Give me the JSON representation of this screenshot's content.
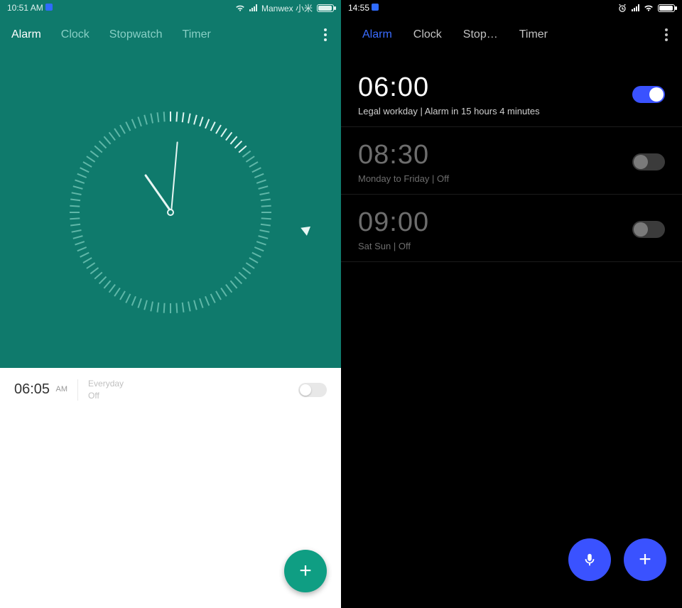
{
  "left": {
    "status": {
      "time": "10:51 AM",
      "carrier": "Manwex 小米"
    },
    "tabs": [
      "Alarm",
      "Clock",
      "Stopwatch",
      "Timer"
    ],
    "active_tab": "Alarm",
    "alarm": {
      "time": "06:05",
      "ampm": "AM",
      "repeat": "Everyday",
      "state": "Off"
    }
  },
  "right": {
    "status": {
      "time": "14:55"
    },
    "tabs": [
      "Alarm",
      "Clock",
      "Stop…",
      "Timer"
    ],
    "active_tab": "Alarm",
    "alarms": [
      {
        "time": "06:00",
        "sub": "Legal workday  |  Alarm in 15 hours 4 minutes",
        "on": true
      },
      {
        "time": "08:30",
        "sub": "Monday to Friday  |  Off",
        "on": false
      },
      {
        "time": "09:00",
        "sub": "Sat Sun  |  Off",
        "on": false
      }
    ]
  }
}
